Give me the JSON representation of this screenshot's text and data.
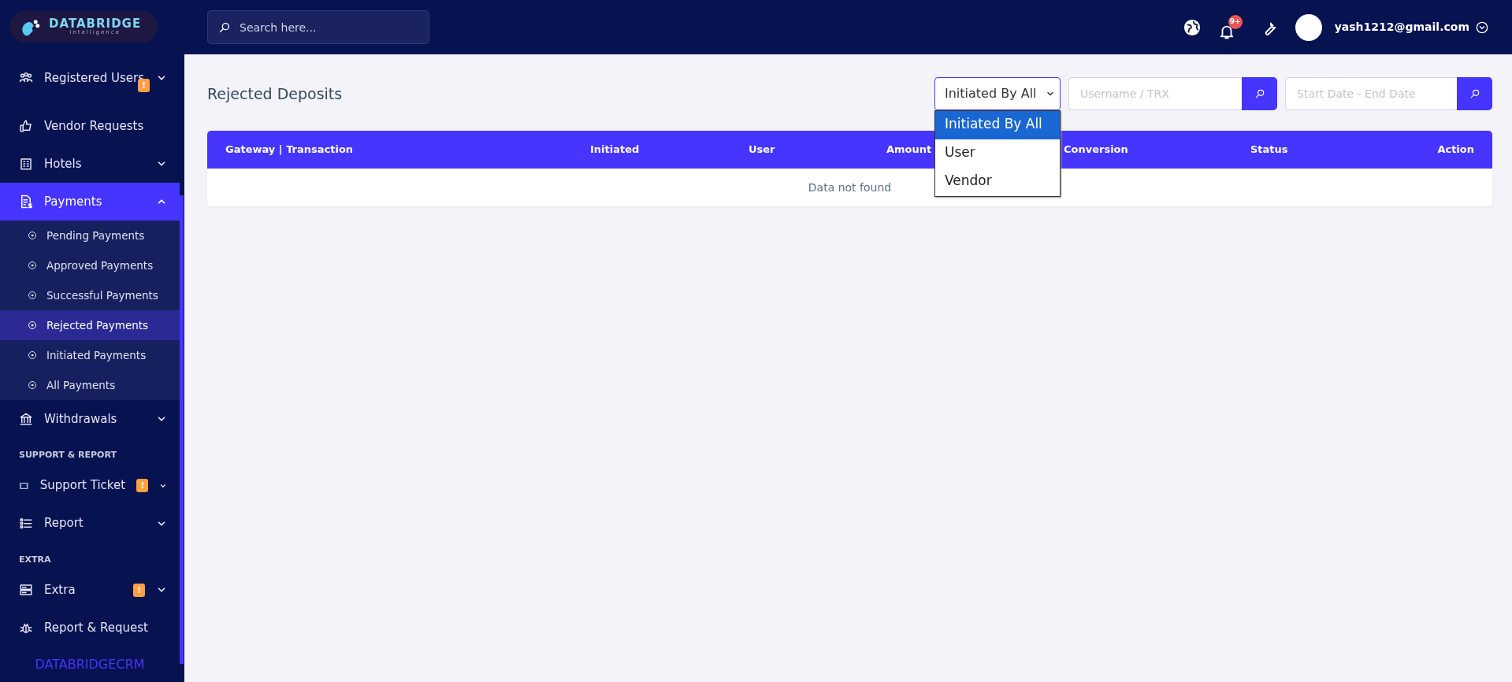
{
  "sidebar": {
    "logo": {
      "title": "DATABRIDGE",
      "subtitle": "Intelligence"
    },
    "items": [
      {
        "kind": "link",
        "label": "Registered Users",
        "expanded": false,
        "badge": "!"
      },
      {
        "kind": "link",
        "label": "Vendor Requests"
      },
      {
        "kind": "link",
        "label": "Hotels",
        "expanded": false
      },
      {
        "kind": "link",
        "label": "Payments",
        "expanded": true,
        "selected": true,
        "children": [
          {
            "label": "Pending Payments",
            "selected": false
          },
          {
            "label": "Approved Payments",
            "selected": false
          },
          {
            "label": "Successful Payments",
            "selected": false
          },
          {
            "label": "Rejected Payments",
            "selected": true
          },
          {
            "label": "Initiated Payments",
            "selected": false
          },
          {
            "label": "All Payments",
            "selected": false
          }
        ]
      },
      {
        "kind": "link",
        "label": "Withdrawals",
        "expanded": false
      },
      {
        "kind": "heading",
        "label": "SUPPORT & REPORT"
      },
      {
        "kind": "link",
        "label": "Support Ticket",
        "expanded": false,
        "badge": "!"
      },
      {
        "kind": "link",
        "label": "Report",
        "expanded": false
      },
      {
        "kind": "heading",
        "label": "EXTRA"
      },
      {
        "kind": "link",
        "label": "Extra",
        "expanded": false,
        "badge": "!"
      },
      {
        "kind": "link",
        "label": "Report & Request"
      }
    ],
    "footer": "DATABRIDGECRM"
  },
  "topbar": {
    "search": {
      "placeholder": "Search here..."
    },
    "notification_count": "9+",
    "user": "yash1212@gmail.com"
  },
  "page": {
    "title": "Rejected Deposits",
    "filter": {
      "value": "Initiated By All",
      "expanded": true,
      "options": [
        {
          "label": "Initiated By All",
          "selected": true
        },
        {
          "label": "User",
          "selected": false
        },
        {
          "label": "Vendor",
          "selected": false
        }
      ]
    },
    "search": {
      "placeholder": "Username / TRX"
    },
    "date_range": {
      "placeholder": "Start Date - End Date"
    }
  },
  "table": {
    "columns": [
      "Gateway | Transaction",
      "Initiated",
      "User",
      "Amount",
      "Conversion",
      "Status",
      "Action"
    ],
    "empty_message": "Data not found"
  }
}
